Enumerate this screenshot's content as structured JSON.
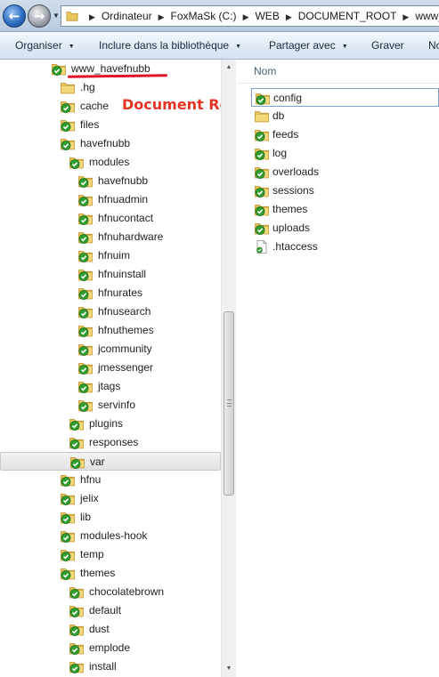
{
  "address_bar": {
    "crumbs": [
      "Ordinateur",
      "FoxMaSk (C:)",
      "WEB",
      "DOCUMENT_ROOT",
      "www_h"
    ]
  },
  "toolbar": {
    "organize_label": "Organiser",
    "include_label": "Inclure dans la bibliothèque",
    "share_label": "Partager avec",
    "burn_label": "Graver",
    "new_label": "No"
  },
  "annotation": {
    "text": "Document Root",
    "color": "#e63323"
  },
  "nav_tree": [
    {
      "label": "www_havefnubb",
      "icon": "synced-folder-icon",
      "level": 0
    },
    {
      "label": ".hg",
      "icon": "folder-icon",
      "level": 1
    },
    {
      "label": "cache",
      "icon": "synced-folder-icon",
      "level": 1
    },
    {
      "label": "files",
      "icon": "synced-folder-icon",
      "level": 1
    },
    {
      "label": "havefnubb",
      "icon": "synced-folder-icon",
      "level": 1
    },
    {
      "label": "modules",
      "icon": "synced-folder-icon",
      "level": 2
    },
    {
      "label": "havefnubb",
      "icon": "synced-folder-icon",
      "level": 3
    },
    {
      "label": "hfnuadmin",
      "icon": "synced-folder-icon",
      "level": 3
    },
    {
      "label": "hfnucontact",
      "icon": "synced-folder-icon",
      "level": 3
    },
    {
      "label": "hfnuhardware",
      "icon": "synced-folder-icon",
      "level": 3
    },
    {
      "label": "hfnuim",
      "icon": "synced-folder-icon",
      "level": 3
    },
    {
      "label": "hfnuinstall",
      "icon": "synced-folder-icon",
      "level": 3
    },
    {
      "label": "hfnurates",
      "icon": "synced-folder-icon",
      "level": 3
    },
    {
      "label": "hfnusearch",
      "icon": "synced-folder-icon",
      "level": 3
    },
    {
      "label": "hfnuthemes",
      "icon": "synced-folder-icon",
      "level": 3
    },
    {
      "label": "jcommunity",
      "icon": "synced-folder-icon",
      "level": 3
    },
    {
      "label": "jmessenger",
      "icon": "synced-folder-icon",
      "level": 3
    },
    {
      "label": "jtags",
      "icon": "synced-folder-icon",
      "level": 3
    },
    {
      "label": "servinfo",
      "icon": "synced-folder-icon",
      "level": 3
    },
    {
      "label": "plugins",
      "icon": "synced-folder-icon",
      "level": 2
    },
    {
      "label": "responses",
      "icon": "synced-folder-icon",
      "level": 2
    },
    {
      "label": "var",
      "icon": "synced-folder-icon",
      "level": 2,
      "selected": true
    },
    {
      "label": "hfnu",
      "icon": "synced-folder-icon",
      "level": 1
    },
    {
      "label": "jelix",
      "icon": "synced-folder-icon",
      "level": 1
    },
    {
      "label": "lib",
      "icon": "synced-folder-icon",
      "level": 1
    },
    {
      "label": "modules-hook",
      "icon": "synced-folder-icon",
      "level": 1
    },
    {
      "label": "temp",
      "icon": "synced-folder-icon",
      "level": 1
    },
    {
      "label": "themes",
      "icon": "synced-folder-icon",
      "level": 1
    },
    {
      "label": "chocolatebrown",
      "icon": "synced-folder-icon",
      "level": 2
    },
    {
      "label": "default",
      "icon": "synced-folder-icon",
      "level": 2
    },
    {
      "label": "dust",
      "icon": "synced-folder-icon",
      "level": 2
    },
    {
      "label": "emplode",
      "icon": "synced-folder-icon",
      "level": 2
    },
    {
      "label": "install",
      "icon": "synced-folder-icon",
      "level": 2
    }
  ],
  "content": {
    "column_name": "Nom",
    "items": [
      {
        "label": "config",
        "icon": "synced-folder-icon",
        "focused": true
      },
      {
        "label": "db",
        "icon": "folder-icon"
      },
      {
        "label": "feeds",
        "icon": "synced-folder-icon"
      },
      {
        "label": "log",
        "icon": "synced-folder-icon"
      },
      {
        "label": "overloads",
        "icon": "synced-folder-icon"
      },
      {
        "label": "sessions",
        "icon": "synced-folder-icon"
      },
      {
        "label": "themes",
        "icon": "synced-folder-icon"
      },
      {
        "label": "uploads",
        "icon": "synced-folder-icon"
      },
      {
        "label": ".htaccess",
        "icon": "file-icon"
      }
    ]
  },
  "colors": {
    "folder": "#e9c55a",
    "sync_badge": "#2f9e2f",
    "annotation_underline": "#e0142a"
  }
}
